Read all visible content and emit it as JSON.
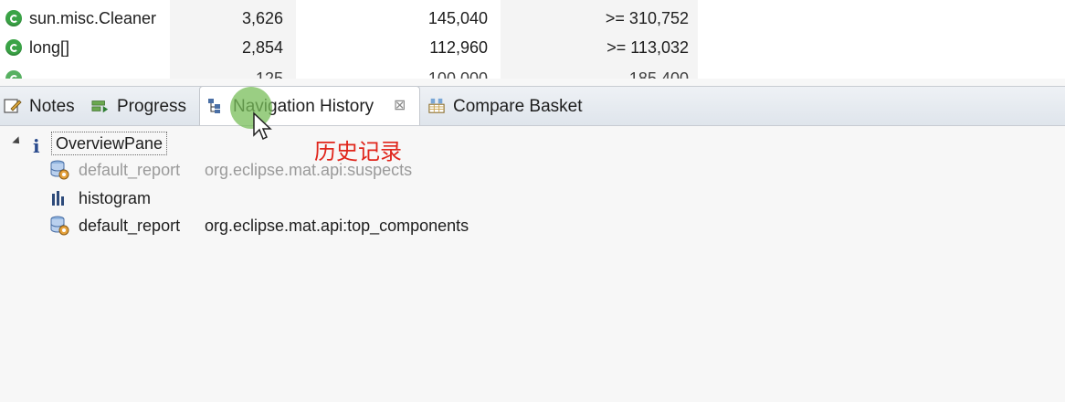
{
  "histogram": {
    "rows": [
      {
        "class_name": "sun.misc.Cleaner",
        "objects": "3,626",
        "shallow_heap": "145,040",
        "retained_heap": ">= 310,752"
      },
      {
        "class_name": "long[]",
        "objects": "2,854",
        "shallow_heap": "112,960",
        "retained_heap": ">= 113,032"
      }
    ],
    "partial_row": {
      "objects": "125",
      "shallow_heap": "100,000",
      "retained_heap": "185,400"
    }
  },
  "tabs": [
    {
      "label": "Notes",
      "icon": "notes-icon"
    },
    {
      "label": "Progress",
      "icon": "progress-icon"
    },
    {
      "label": "Navigation History",
      "icon": "navigation-history-icon",
      "active": true
    },
    {
      "label": "Compare Basket",
      "icon": "compare-basket-icon"
    }
  ],
  "tree": {
    "root": {
      "label": "OverviewPane",
      "icon": "info-icon"
    },
    "children": [
      {
        "name": "default_report",
        "detail": "org.eclipse.mat.api:suspects",
        "icon": "report-icon",
        "muted": true
      },
      {
        "name": "histogram",
        "detail": "",
        "icon": "histogram-icon",
        "muted": false
      },
      {
        "name": "default_report",
        "detail": "org.eclipse.mat.api:top_components",
        "icon": "report-icon",
        "muted": false
      }
    ]
  },
  "annotation": "历史记录",
  "colors": {
    "accent_annotation": "#e0251b",
    "class_icon": "#3aa346",
    "active_tab": "#ffffff"
  }
}
